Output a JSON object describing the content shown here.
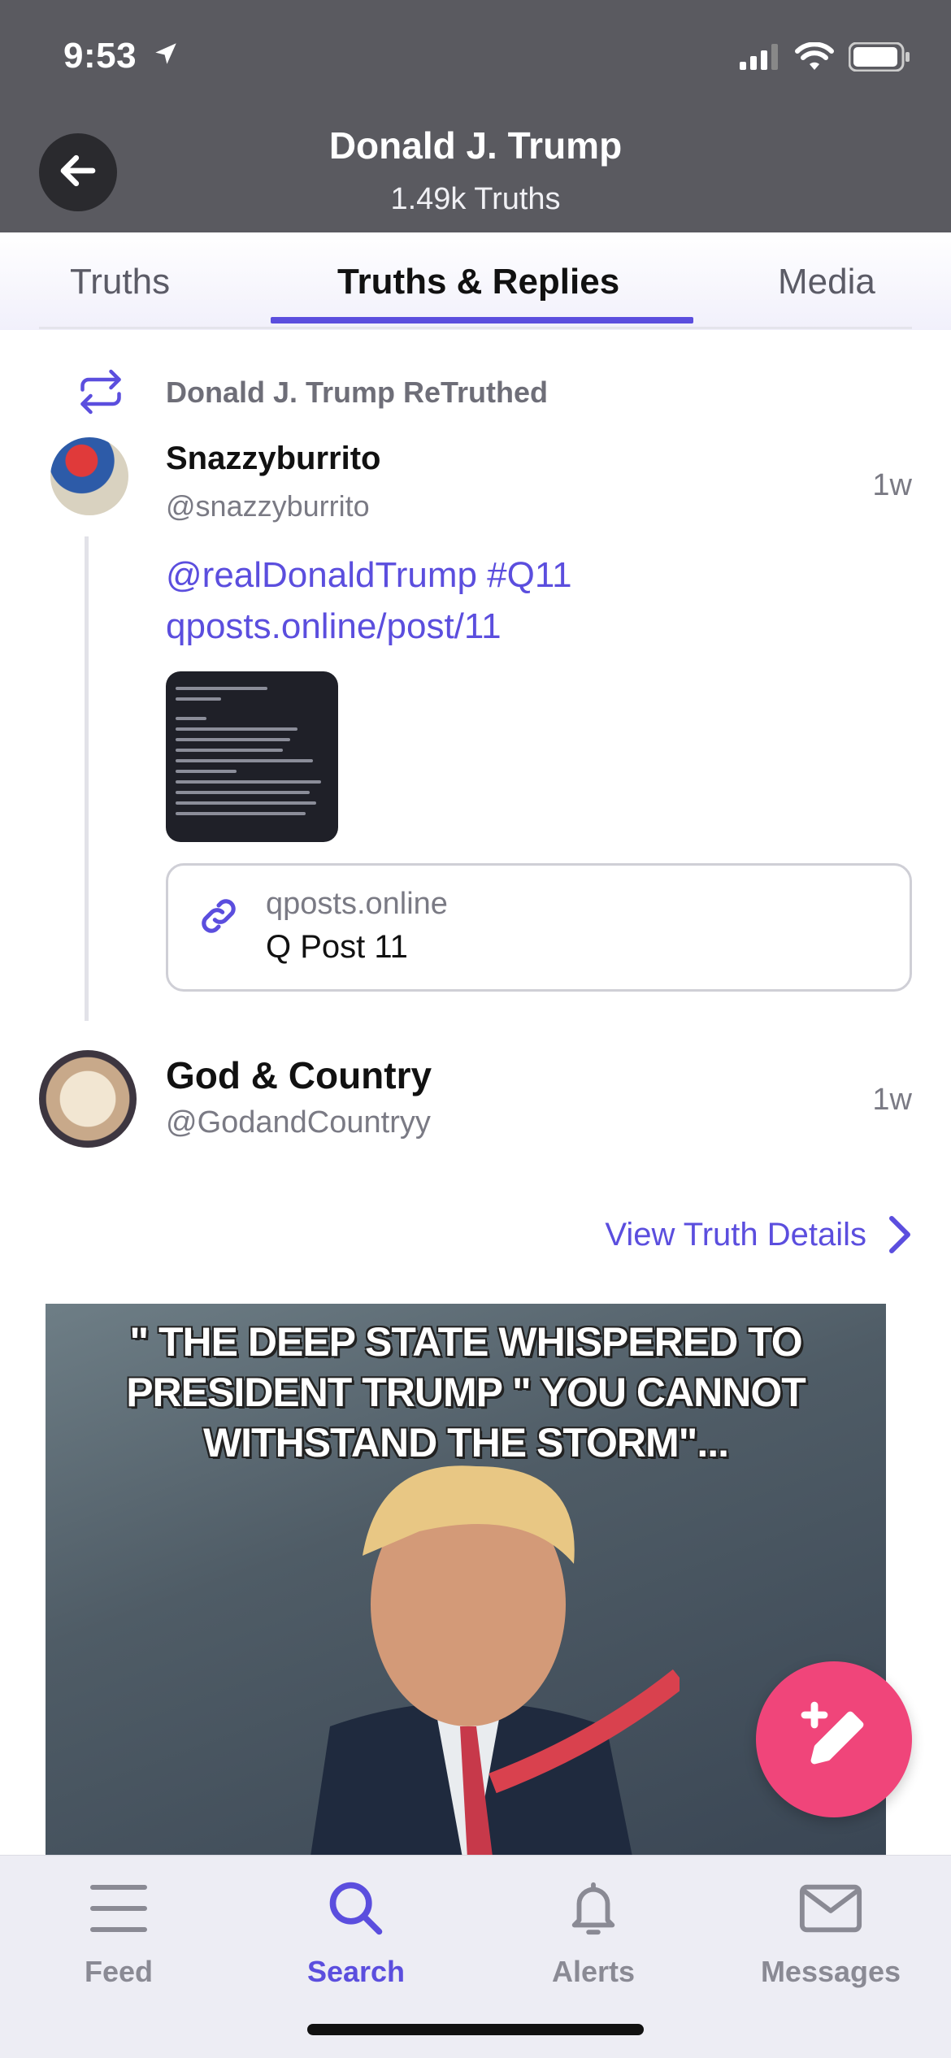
{
  "status_bar": {
    "time": "9:53"
  },
  "header": {
    "title": "Donald J. Trump",
    "subtitle": "1.49k Truths"
  },
  "tabs": [
    {
      "label": "Truths",
      "active": false
    },
    {
      "label": "Truths & Replies",
      "active": true
    },
    {
      "label": "Media",
      "active": false
    }
  ],
  "retruth": {
    "label": "Donald J. Trump ReTruthed"
  },
  "post1": {
    "name": "Snazzyburrito",
    "handle": "@snazzyburrito",
    "time": "1w",
    "text": "@realDonaldTrump #Q11 qposts.online/post/11",
    "link_card": {
      "domain": "qposts.online",
      "title": "Q Post 11"
    }
  },
  "post2": {
    "name": "God & Country",
    "handle": "@GodandCountryy",
    "time": "1w",
    "view_details": "View Truth Details",
    "meme_caption": "\" THE DEEP STATE WHISPERED TO PRESIDENT TRUMP \" YOU CANNOT WITHSTAND THE STORM\"..."
  },
  "bottom_nav": [
    {
      "label": "Feed",
      "icon": "feed-icon",
      "active": false
    },
    {
      "label": "Search",
      "icon": "search-icon",
      "active": true
    },
    {
      "label": "Alerts",
      "icon": "bell-icon",
      "active": false
    },
    {
      "label": "Messages",
      "icon": "envelope-icon",
      "active": false
    }
  ],
  "colors": {
    "accent": "#5b4ede",
    "fab": "#f0457a",
    "header_bg": "#5a5a60"
  }
}
